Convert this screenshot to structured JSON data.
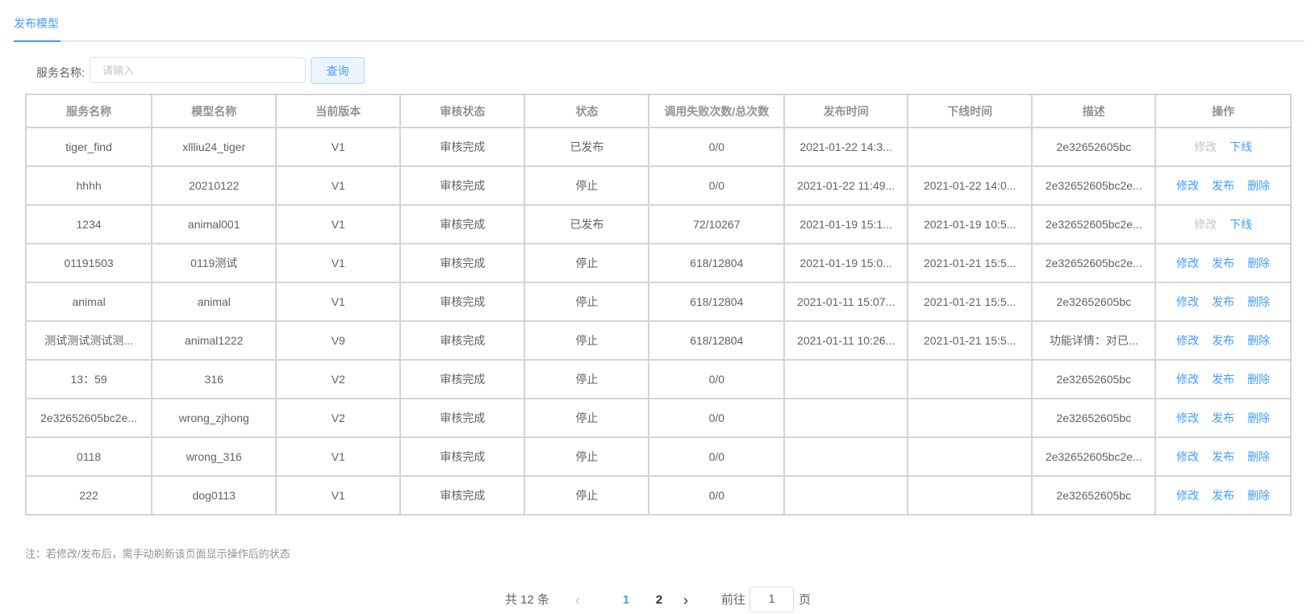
{
  "tabs": {
    "active_label": "发布模型"
  },
  "search": {
    "label": "服务名称:",
    "placeholder": "请输入",
    "value": "",
    "button_label": "查询"
  },
  "table": {
    "columns": [
      "服务名称",
      "模型名称",
      "当前版本",
      "审核状态",
      "状态",
      "调用失败次数/总次数",
      "发布时间",
      "下线时间",
      "描述",
      "操作"
    ],
    "rows": [
      {
        "service": "tiger_find",
        "model": "xllliu24_tiger",
        "version": "V1",
        "review": "审核完成",
        "status": "已发布",
        "status_type": "published",
        "calls": "0/0",
        "publish_time": "2021-01-22 14:3...",
        "offline_time": "",
        "desc": "2e32652605bc",
        "actions": [
          {
            "label": "修改",
            "enabled": false
          },
          {
            "label": "下线",
            "enabled": true
          }
        ]
      },
      {
        "service": "hhhh",
        "model": "20210122",
        "version": "V1",
        "review": "审核完成",
        "status": "停止",
        "status_type": "stopped-orange",
        "calls": "0/0",
        "publish_time": "2021-01-22 11:49...",
        "offline_time": "2021-01-22 14:0...",
        "desc": "2e32652605bc2e...",
        "actions": [
          {
            "label": "修改",
            "enabled": true
          },
          {
            "label": "发布",
            "enabled": true
          },
          {
            "label": "删除",
            "enabled": true
          }
        ]
      },
      {
        "service": "1234",
        "model": "animal001",
        "version": "V1",
        "review": "审核完成",
        "status": "已发布",
        "status_type": "published",
        "calls": "72/10267",
        "publish_time": "2021-01-19 15:1...",
        "offline_time": "2021-01-19 10:5...",
        "desc": "2e32652605bc2e...",
        "actions": [
          {
            "label": "修改",
            "enabled": false
          },
          {
            "label": "下线",
            "enabled": true
          }
        ]
      },
      {
        "service": "01191503",
        "model": "0119测试",
        "version": "V1",
        "review": "审核完成",
        "status": "停止",
        "status_type": "stopped-orange",
        "calls": "618/12804",
        "publish_time": "2021-01-19 15:0...",
        "offline_time": "2021-01-21 15:5...",
        "desc": "2e32652605bc2e...",
        "actions": [
          {
            "label": "修改",
            "enabled": true
          },
          {
            "label": "发布",
            "enabled": true
          },
          {
            "label": "删除",
            "enabled": true
          }
        ]
      },
      {
        "service": "animal",
        "model": "animal",
        "version": "V1",
        "review": "审核完成",
        "status": "停止",
        "status_type": "stopped-orange",
        "calls": "618/12804",
        "publish_time": "2021-01-11 15:07...",
        "offline_time": "2021-01-21 15:5...",
        "desc": "2e32652605bc",
        "actions": [
          {
            "label": "修改",
            "enabled": true
          },
          {
            "label": "发布",
            "enabled": true
          },
          {
            "label": "删除",
            "enabled": true
          }
        ]
      },
      {
        "service": "测试测试测试测...",
        "model": "animal1222",
        "version": "V9",
        "review": "审核完成",
        "status": "停止",
        "status_type": "stopped-orange",
        "calls": "618/12804",
        "publish_time": "2021-01-11 10:26...",
        "offline_time": "2021-01-21 15:5...",
        "desc": "功能详情：对已...",
        "actions": [
          {
            "label": "修改",
            "enabled": true
          },
          {
            "label": "发布",
            "enabled": true
          },
          {
            "label": "删除",
            "enabled": true
          }
        ]
      },
      {
        "service": "13：59",
        "model": "316",
        "version": "V2",
        "review": "审核完成",
        "status": "停止",
        "status_type": "stopped-red",
        "calls": "0/0",
        "publish_time": "",
        "offline_time": "",
        "desc": "2e32652605bc",
        "actions": [
          {
            "label": "修改",
            "enabled": true
          },
          {
            "label": "发布",
            "enabled": true
          },
          {
            "label": "删除",
            "enabled": true
          }
        ]
      },
      {
        "service": "2e32652605bc2e...",
        "model": "wrong_zjhong",
        "version": "V2",
        "review": "审核完成",
        "status": "停止",
        "status_type": "stopped-red",
        "calls": "0/0",
        "publish_time": "",
        "offline_time": "",
        "desc": "2e32652605bc",
        "actions": [
          {
            "label": "修改",
            "enabled": true
          },
          {
            "label": "发布",
            "enabled": true
          },
          {
            "label": "删除",
            "enabled": true
          }
        ]
      },
      {
        "service": "0118",
        "model": "wrong_316",
        "version": "V1",
        "review": "审核完成",
        "status": "停止",
        "status_type": "stopped-red",
        "calls": "0/0",
        "publish_time": "",
        "offline_time": "",
        "desc": "2e32652605bc2e...",
        "actions": [
          {
            "label": "修改",
            "enabled": true
          },
          {
            "label": "发布",
            "enabled": true
          },
          {
            "label": "删除",
            "enabled": true
          }
        ]
      },
      {
        "service": "222",
        "model": "dog0113",
        "version": "V1",
        "review": "审核完成",
        "status": "停止",
        "status_type": "stopped-red",
        "calls": "0/0",
        "publish_time": "",
        "offline_time": "",
        "desc": "2e32652605bc",
        "actions": [
          {
            "label": "修改",
            "enabled": true
          },
          {
            "label": "发布",
            "enabled": true
          },
          {
            "label": "删除",
            "enabled": true
          }
        ]
      }
    ]
  },
  "note": "注：若修改/发布后，需手动刷新该页面显示操作后的状态",
  "pagination": {
    "total_text": "共 12 条",
    "prev_icon": "chevron-left-icon",
    "pages": [
      "1",
      "2"
    ],
    "current_page": "1",
    "next_icon": "chevron-right-icon",
    "goto_label": "前往",
    "goto_value": "1",
    "goto_suffix": "页"
  },
  "colors": {
    "primary": "#409eff",
    "warning": "#e6a23c",
    "danger": "#f56c6c",
    "border": "#d4d4d4",
    "header_text": "#909399"
  }
}
